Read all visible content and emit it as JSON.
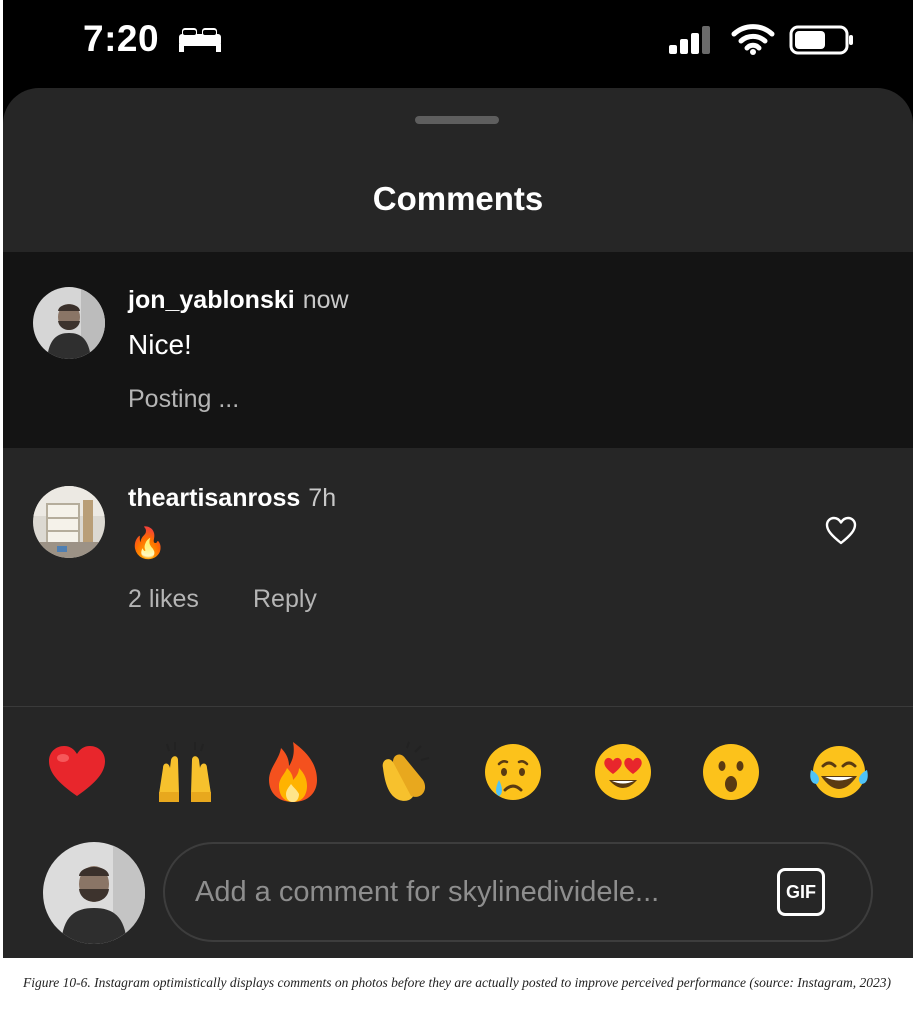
{
  "status_bar": {
    "time": "7:20",
    "icons": [
      "bed-icon",
      "cellular-signal-icon",
      "wifi-icon",
      "battery-icon"
    ]
  },
  "sheet": {
    "title": "Comments"
  },
  "comments": [
    {
      "username": "jon_yablonski",
      "timestamp": "now",
      "text": "Nice!",
      "status": "Posting ..."
    },
    {
      "username": "theartisanross",
      "timestamp": "7h",
      "text": "🔥",
      "likes_label": "2 likes",
      "reply_label": "Reply",
      "like_icon": "heart-outline-icon"
    }
  ],
  "quick_reactions": [
    {
      "name": "red-heart",
      "glyph": "❤️"
    },
    {
      "name": "raising-hands",
      "glyph": "🙌"
    },
    {
      "name": "fire",
      "glyph": "🔥"
    },
    {
      "name": "clapping-hands",
      "glyph": "👏"
    },
    {
      "name": "crying-face",
      "glyph": "😢"
    },
    {
      "name": "heart-eyes",
      "glyph": "😍"
    },
    {
      "name": "surprised-face",
      "glyph": "😮"
    },
    {
      "name": "tears-of-joy",
      "glyph": "😂"
    }
  ],
  "composer": {
    "placeholder": "Add a comment for skylinedividele...",
    "gif_label": "GIF"
  },
  "caption": "Figure 10-6. Instagram optimistically displays comments on photos before they are actually posted to improve perceived performance (source: Instagram, 2023)",
  "colors": {
    "sheet_background": "#262626",
    "pending_comment_background": "#141414",
    "status_bar_background": "#000000"
  }
}
